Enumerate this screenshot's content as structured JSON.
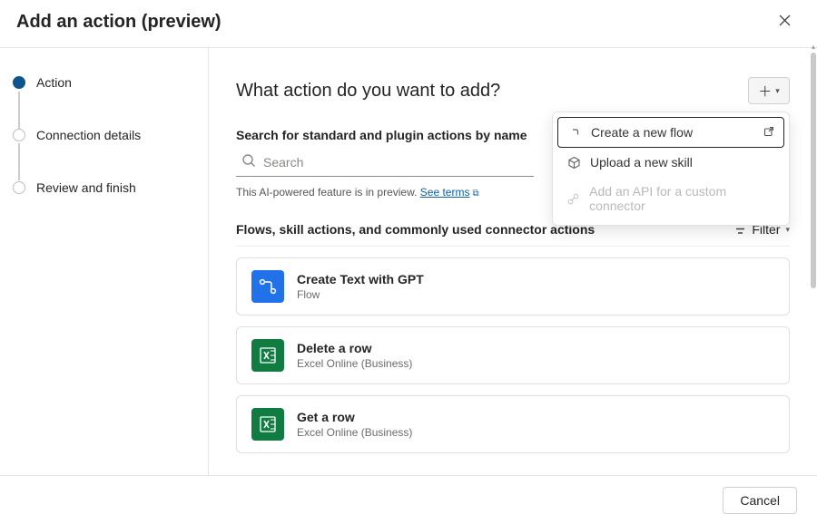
{
  "header": {
    "title": "Add an action (preview)"
  },
  "sidebar": {
    "steps": [
      {
        "label": "Action",
        "active": true
      },
      {
        "label": "Connection details",
        "active": false
      },
      {
        "label": "Review and finish",
        "active": false
      }
    ]
  },
  "main": {
    "title": "What action do you want to add?",
    "search_label": "Search for standard and plugin actions by name",
    "search_placeholder": "Search",
    "preview_note_prefix": "This AI-powered feature is in preview. ",
    "preview_link": "See terms",
    "section_title": "Flows, skill actions, and commonly used connector actions",
    "filter_label": "Filter",
    "cards": [
      {
        "title": "Create Text with GPT",
        "subtitle": "Flow",
        "icon": "flow",
        "color": "blue"
      },
      {
        "title": "Delete a row",
        "subtitle": "Excel Online (Business)",
        "icon": "excel",
        "color": "green"
      },
      {
        "title": "Get a row",
        "subtitle": "Excel Online (Business)",
        "icon": "excel",
        "color": "green"
      }
    ]
  },
  "add_menu": {
    "items": [
      {
        "label": "Create a new flow",
        "icon": "flow",
        "highlight": true,
        "external": true,
        "disabled": false
      },
      {
        "label": "Upload a new skill",
        "icon": "cube",
        "highlight": false,
        "external": false,
        "disabled": false
      },
      {
        "label": "Add an API for a custom connector",
        "icon": "plug",
        "highlight": false,
        "external": false,
        "disabled": true
      }
    ]
  },
  "footer": {
    "cancel": "Cancel"
  }
}
